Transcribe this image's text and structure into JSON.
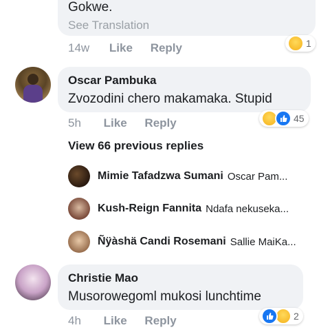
{
  "comment1": {
    "text": "Gokwe.",
    "see_translation": "See Translation",
    "time": "14w",
    "like_label": "Like",
    "reply_label": "Reply",
    "reaction_count": "1"
  },
  "comment2": {
    "author": "Oscar Pambuka",
    "text": "Zvozodini chero makamaka. Stupid",
    "time": "5h",
    "like_label": "Like",
    "reply_label": "Reply",
    "reaction_count": "45"
  },
  "view_replies": "View 66 previous replies",
  "replies": [
    {
      "author": "Mimie Tafadzwa Sumani",
      "preview": "Oscar Pam..."
    },
    {
      "author": "Kush-Reign Fannita",
      "preview": "Ndafa nekuseka..."
    },
    {
      "author": "Ñÿàshä Candi Rosemani",
      "preview": "Sallie MaiKa..."
    }
  ],
  "comment3": {
    "author": "Christie Mao",
    "text": "Musorowegoml mukosi lunchtime",
    "time": "4h",
    "like_label": "Like",
    "reply_label": "Reply",
    "reaction_count": "2"
  },
  "colors": {
    "bubble": "#f0f2f5",
    "like_blue": "#1877f2",
    "meta_gray": "#8d949e"
  }
}
